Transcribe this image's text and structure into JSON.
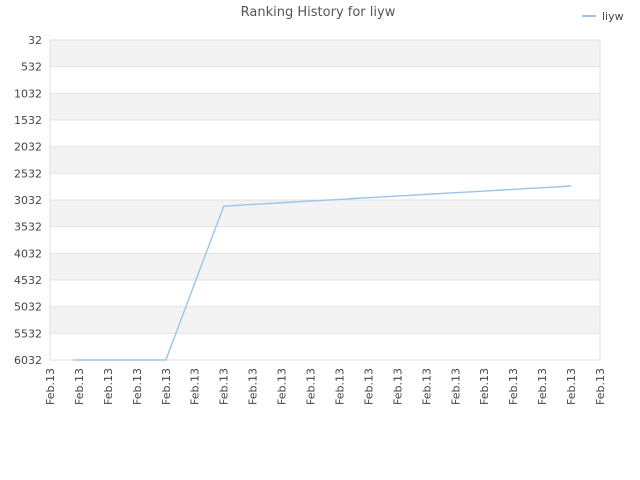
{
  "chart_data": {
    "type": "line",
    "title": "Ranking History for liyw",
    "xlabel": "",
    "ylabel": "",
    "y_inverted": true,
    "ylim": [
      32,
      6032
    ],
    "y_ticks": [
      "32",
      "532",
      "1032",
      "1532",
      "2032",
      "2532",
      "3032",
      "3532",
      "4032",
      "4532",
      "5032",
      "5532",
      "6032"
    ],
    "x_ticks": [
      "Feb.13",
      "Feb.13",
      "Feb.13",
      "Feb.13",
      "Feb.13",
      "Feb.13",
      "Feb.13",
      "Feb.13",
      "Feb.13",
      "Feb.13",
      "Feb.13",
      "Feb.13",
      "Feb.13",
      "Feb.13",
      "Feb.13",
      "Feb.13",
      "Feb.13",
      "Feb.13",
      "Feb.13",
      "Feb.13"
    ],
    "x_tick_rotation": -90,
    "grid": true,
    "alternating_bands": true,
    "legend": {
      "position": "top-right",
      "entries": [
        "liyw"
      ]
    },
    "colors": {
      "series": "#99c5ea",
      "band": "#f3f3f3",
      "grid": "#e2e2e2",
      "axis": "#cccccc"
    },
    "series": [
      {
        "name": "liyw",
        "x": [
          0.8,
          1.6,
          2.4,
          3.2,
          4.0,
          6.0,
          6.8,
          7.6,
          8.4,
          9.2,
          10.0,
          10.8,
          11.6,
          12.4,
          13.2,
          14.0,
          14.8,
          15.6,
          16.4,
          17.2,
          18.0
        ],
        "values": [
          6032,
          6032,
          6032,
          6032,
          6032,
          3150,
          3120,
          3095,
          3070,
          3045,
          3020,
          2995,
          2970,
          2945,
          2920,
          2895,
          2870,
          2845,
          2820,
          2795,
          2770
        ]
      }
    ]
  }
}
